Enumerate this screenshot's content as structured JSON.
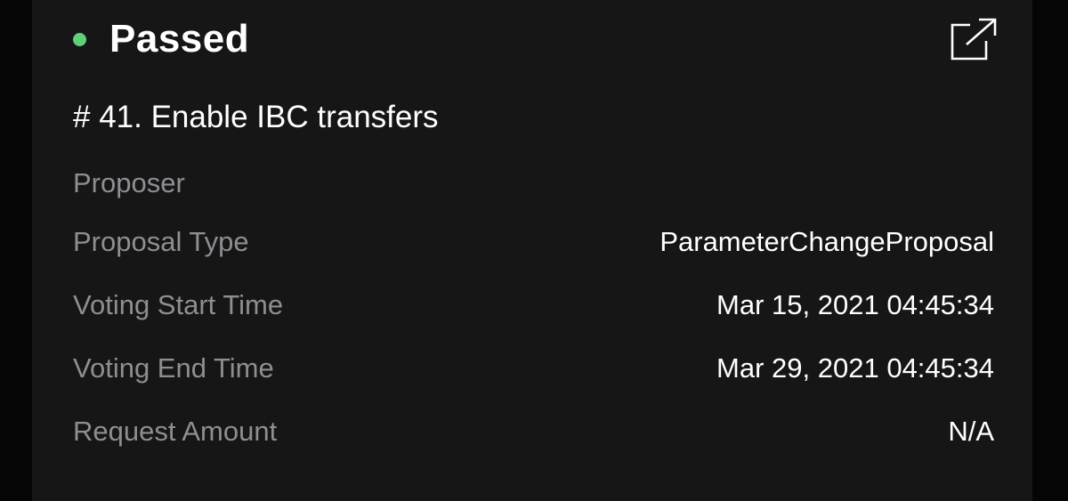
{
  "status": {
    "label": "Passed",
    "color": "#5fd07a"
  },
  "header": {
    "external_link_icon": "external-link-icon"
  },
  "proposal": {
    "title": "# 41. Enable IBC transfers"
  },
  "details": {
    "rows": [
      {
        "label": "Proposer",
        "value": ""
      },
      {
        "label": "Proposal Type",
        "value": "ParameterChangeProposal"
      },
      {
        "label": "Voting Start Time",
        "value": "Mar 15, 2021 04:45:34"
      },
      {
        "label": "Voting End Time",
        "value": "Mar 29, 2021 04:45:34"
      },
      {
        "label": "Request Amount",
        "value": "N/A"
      }
    ]
  }
}
